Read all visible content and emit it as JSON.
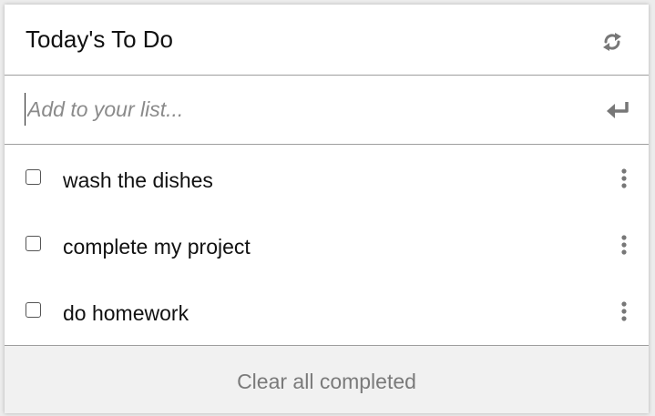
{
  "header": {
    "title": "Today's To Do",
    "refresh_icon": "refresh-icon"
  },
  "add_item": {
    "placeholder": "Add to your list...",
    "value": "",
    "submit_icon": "enter-icon"
  },
  "todos": [
    {
      "label": "wash the dishes",
      "completed": false
    },
    {
      "label": "complete my project",
      "completed": false
    },
    {
      "label": "do homework",
      "completed": false
    }
  ],
  "footer": {
    "clear_label": "Clear all completed"
  },
  "colors": {
    "icon": "#777777",
    "divider": "#9e9e9e",
    "footer_bg": "#f1f1f1",
    "footer_text": "#7a7a7a",
    "placeholder": "#8a8a8a"
  }
}
